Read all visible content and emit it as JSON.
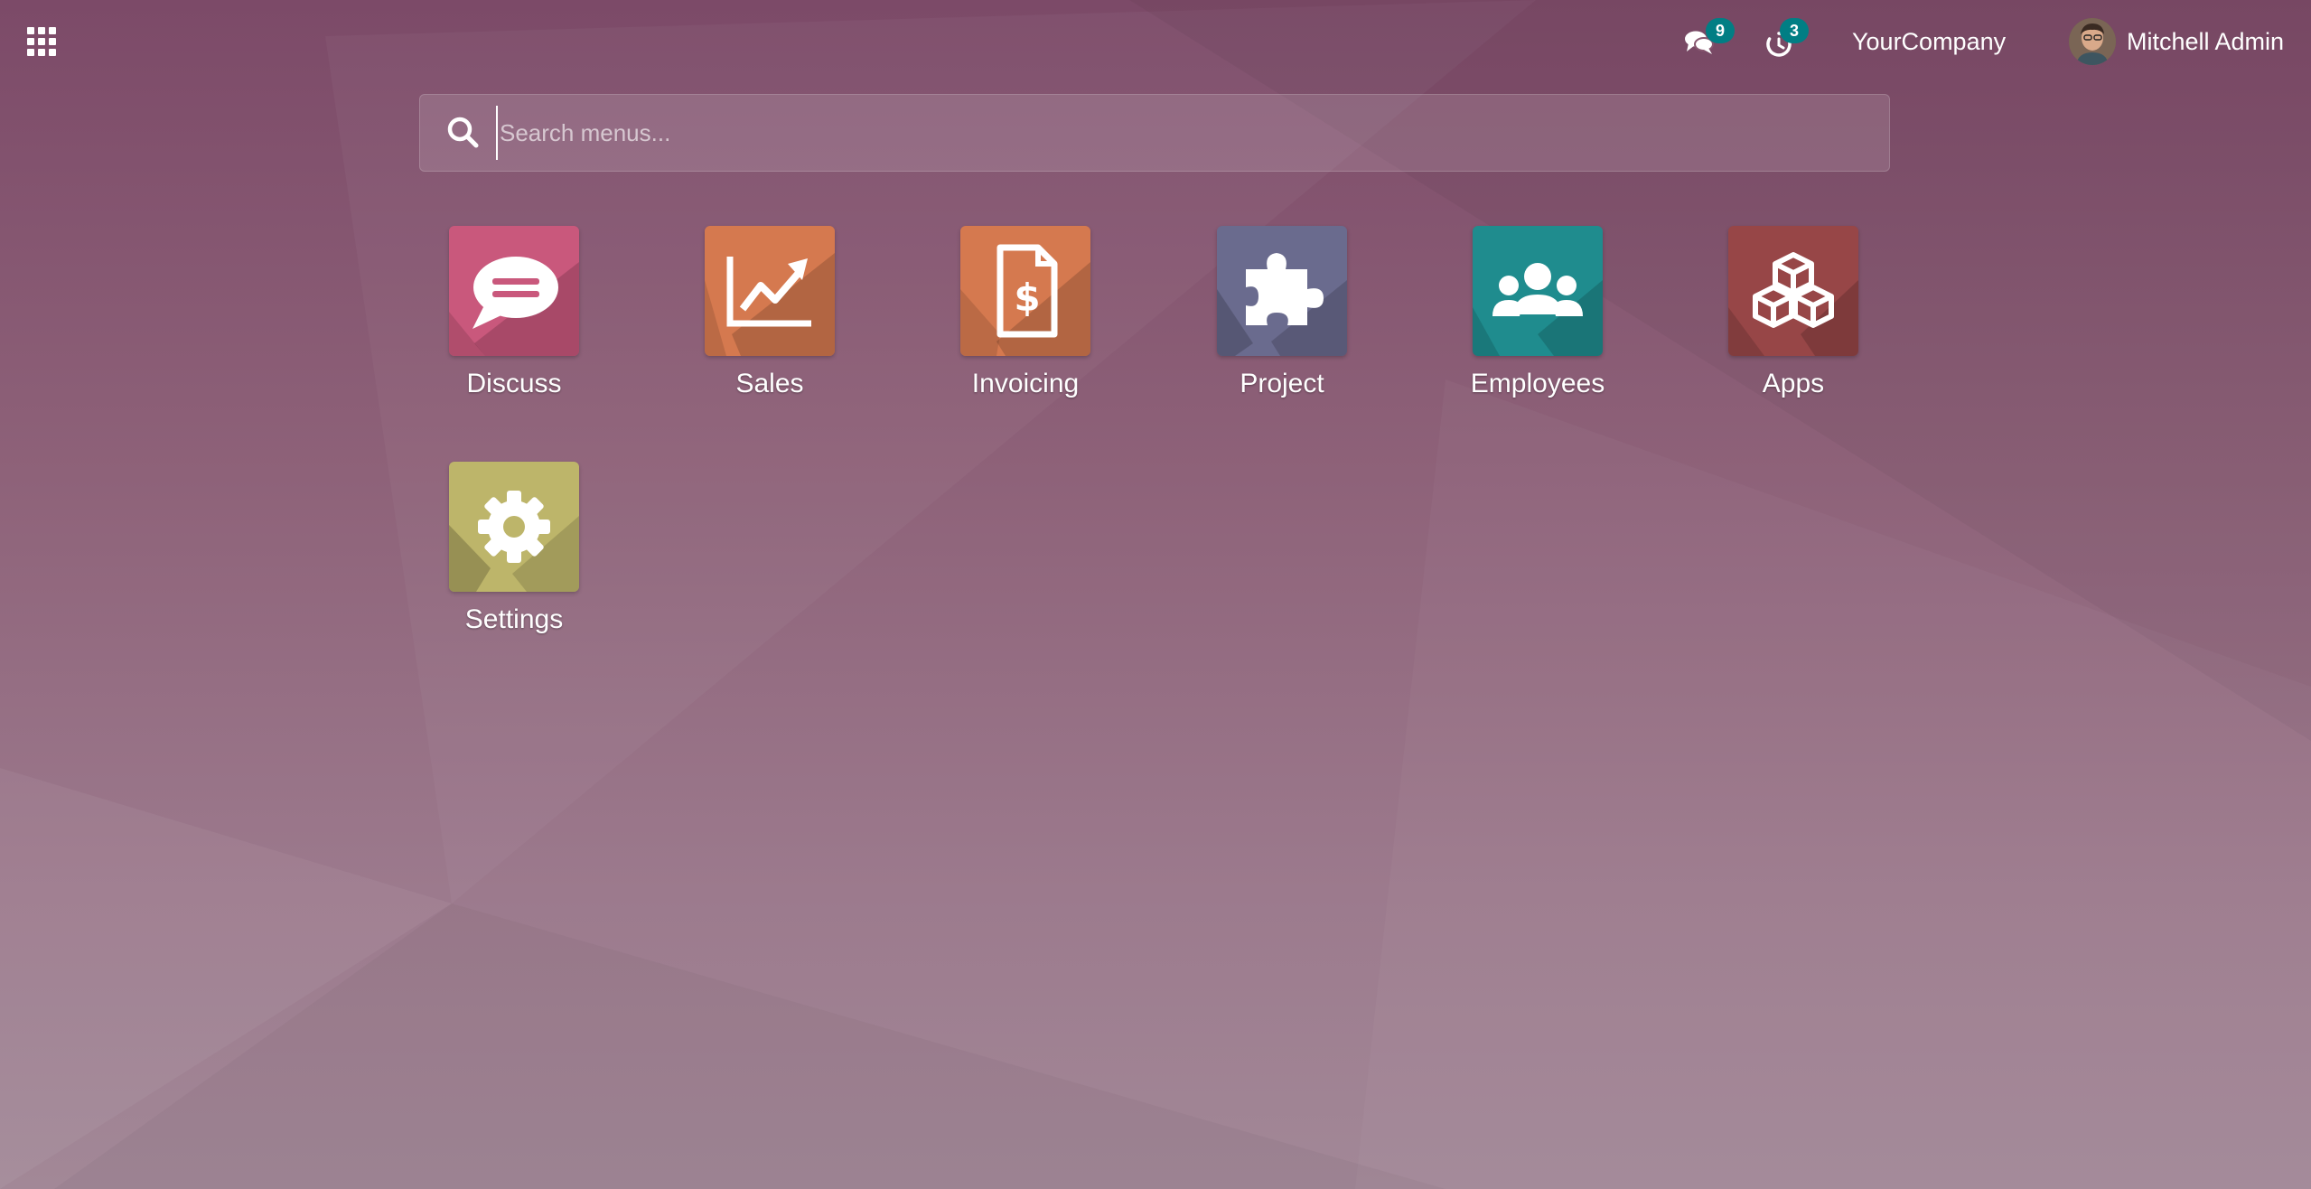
{
  "topbar": {
    "apps_menu_icon": "grid-icon",
    "messages": {
      "icon": "chat-bubbles-icon",
      "count": "9"
    },
    "activities": {
      "icon": "clock-icon",
      "count": "3"
    },
    "company_name": "YourCompany",
    "user": {
      "name": "Mitchell Admin",
      "avatar": "user-avatar"
    }
  },
  "search": {
    "icon": "search-icon",
    "placeholder": "Search menus...",
    "value": ""
  },
  "apps": [
    {
      "label": "Discuss",
      "icon": "speech-bubble-icon",
      "color": "#c9587c"
    },
    {
      "label": "Sales",
      "icon": "trend-chart-icon",
      "color": "#d5794f"
    },
    {
      "label": "Invoicing",
      "icon": "dollar-document-icon",
      "color": "#d5794f"
    },
    {
      "label": "Project",
      "icon": "puzzle-piece-icon",
      "color": "#6a6b8e"
    },
    {
      "label": "Employees",
      "icon": "people-group-icon",
      "color": "#1f8c8e"
    },
    {
      "label": "Apps",
      "icon": "cubes-icon",
      "color": "#974647"
    },
    {
      "label": "Settings",
      "icon": "gear-icon",
      "color": "#bdb56a"
    }
  ],
  "colors": {
    "badge": "#017e84",
    "background_top": "#7c4a68",
    "background_bottom": "#a28897"
  }
}
